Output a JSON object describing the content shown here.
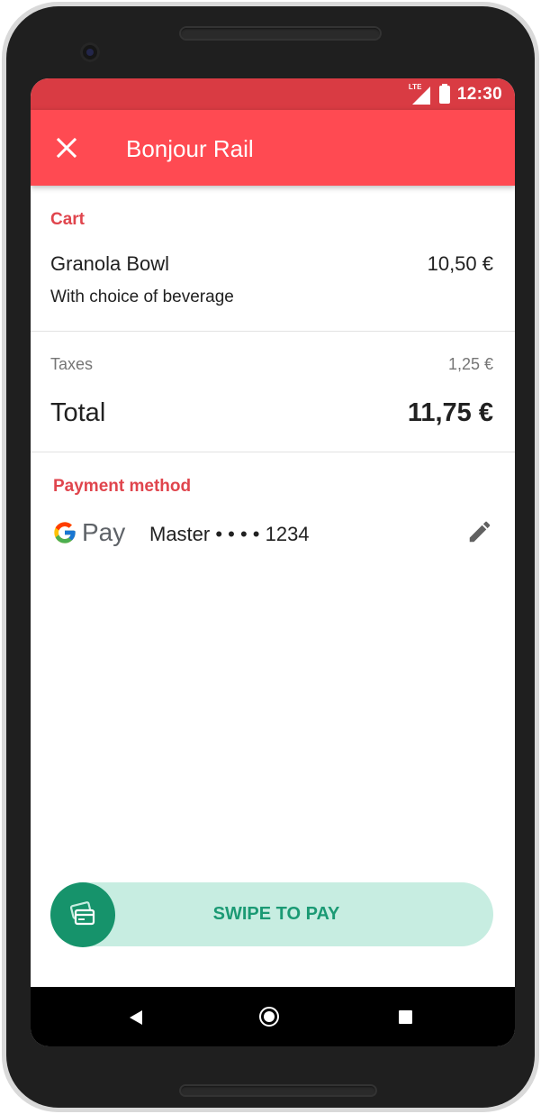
{
  "status_bar": {
    "network": "LTE",
    "time": "12:30"
  },
  "app_bar": {
    "title": "Bonjour Rail",
    "close_icon": "close-icon"
  },
  "cart": {
    "section_label": "Cart",
    "item": {
      "name": "Granola Bowl",
      "price": "10,50 €",
      "description": "With choice of beverage"
    }
  },
  "summary": {
    "taxes_label": "Taxes",
    "taxes_value": "1,25 €",
    "total_label": "Total",
    "total_value": "11,75 €"
  },
  "payment": {
    "section_label": "Payment method",
    "provider_logo": "google-pay-logo",
    "provider_text": "Pay",
    "card": "Master • • • • 1234",
    "edit_icon": "pencil-icon"
  },
  "swipe": {
    "label": "SWIPE TO PAY",
    "icon": "card-icon"
  },
  "nav": {
    "back_icon": "back-triangle-icon",
    "home_icon": "home-circle-icon",
    "recent_icon": "recents-square-icon"
  },
  "colors": {
    "status_bar": "#d93b43",
    "app_bar": "#ff4a52",
    "accent_text": "#e0454d",
    "swipe_track": "#c7ede1",
    "swipe_knob": "#16936b",
    "swipe_text": "#1b9a74"
  }
}
